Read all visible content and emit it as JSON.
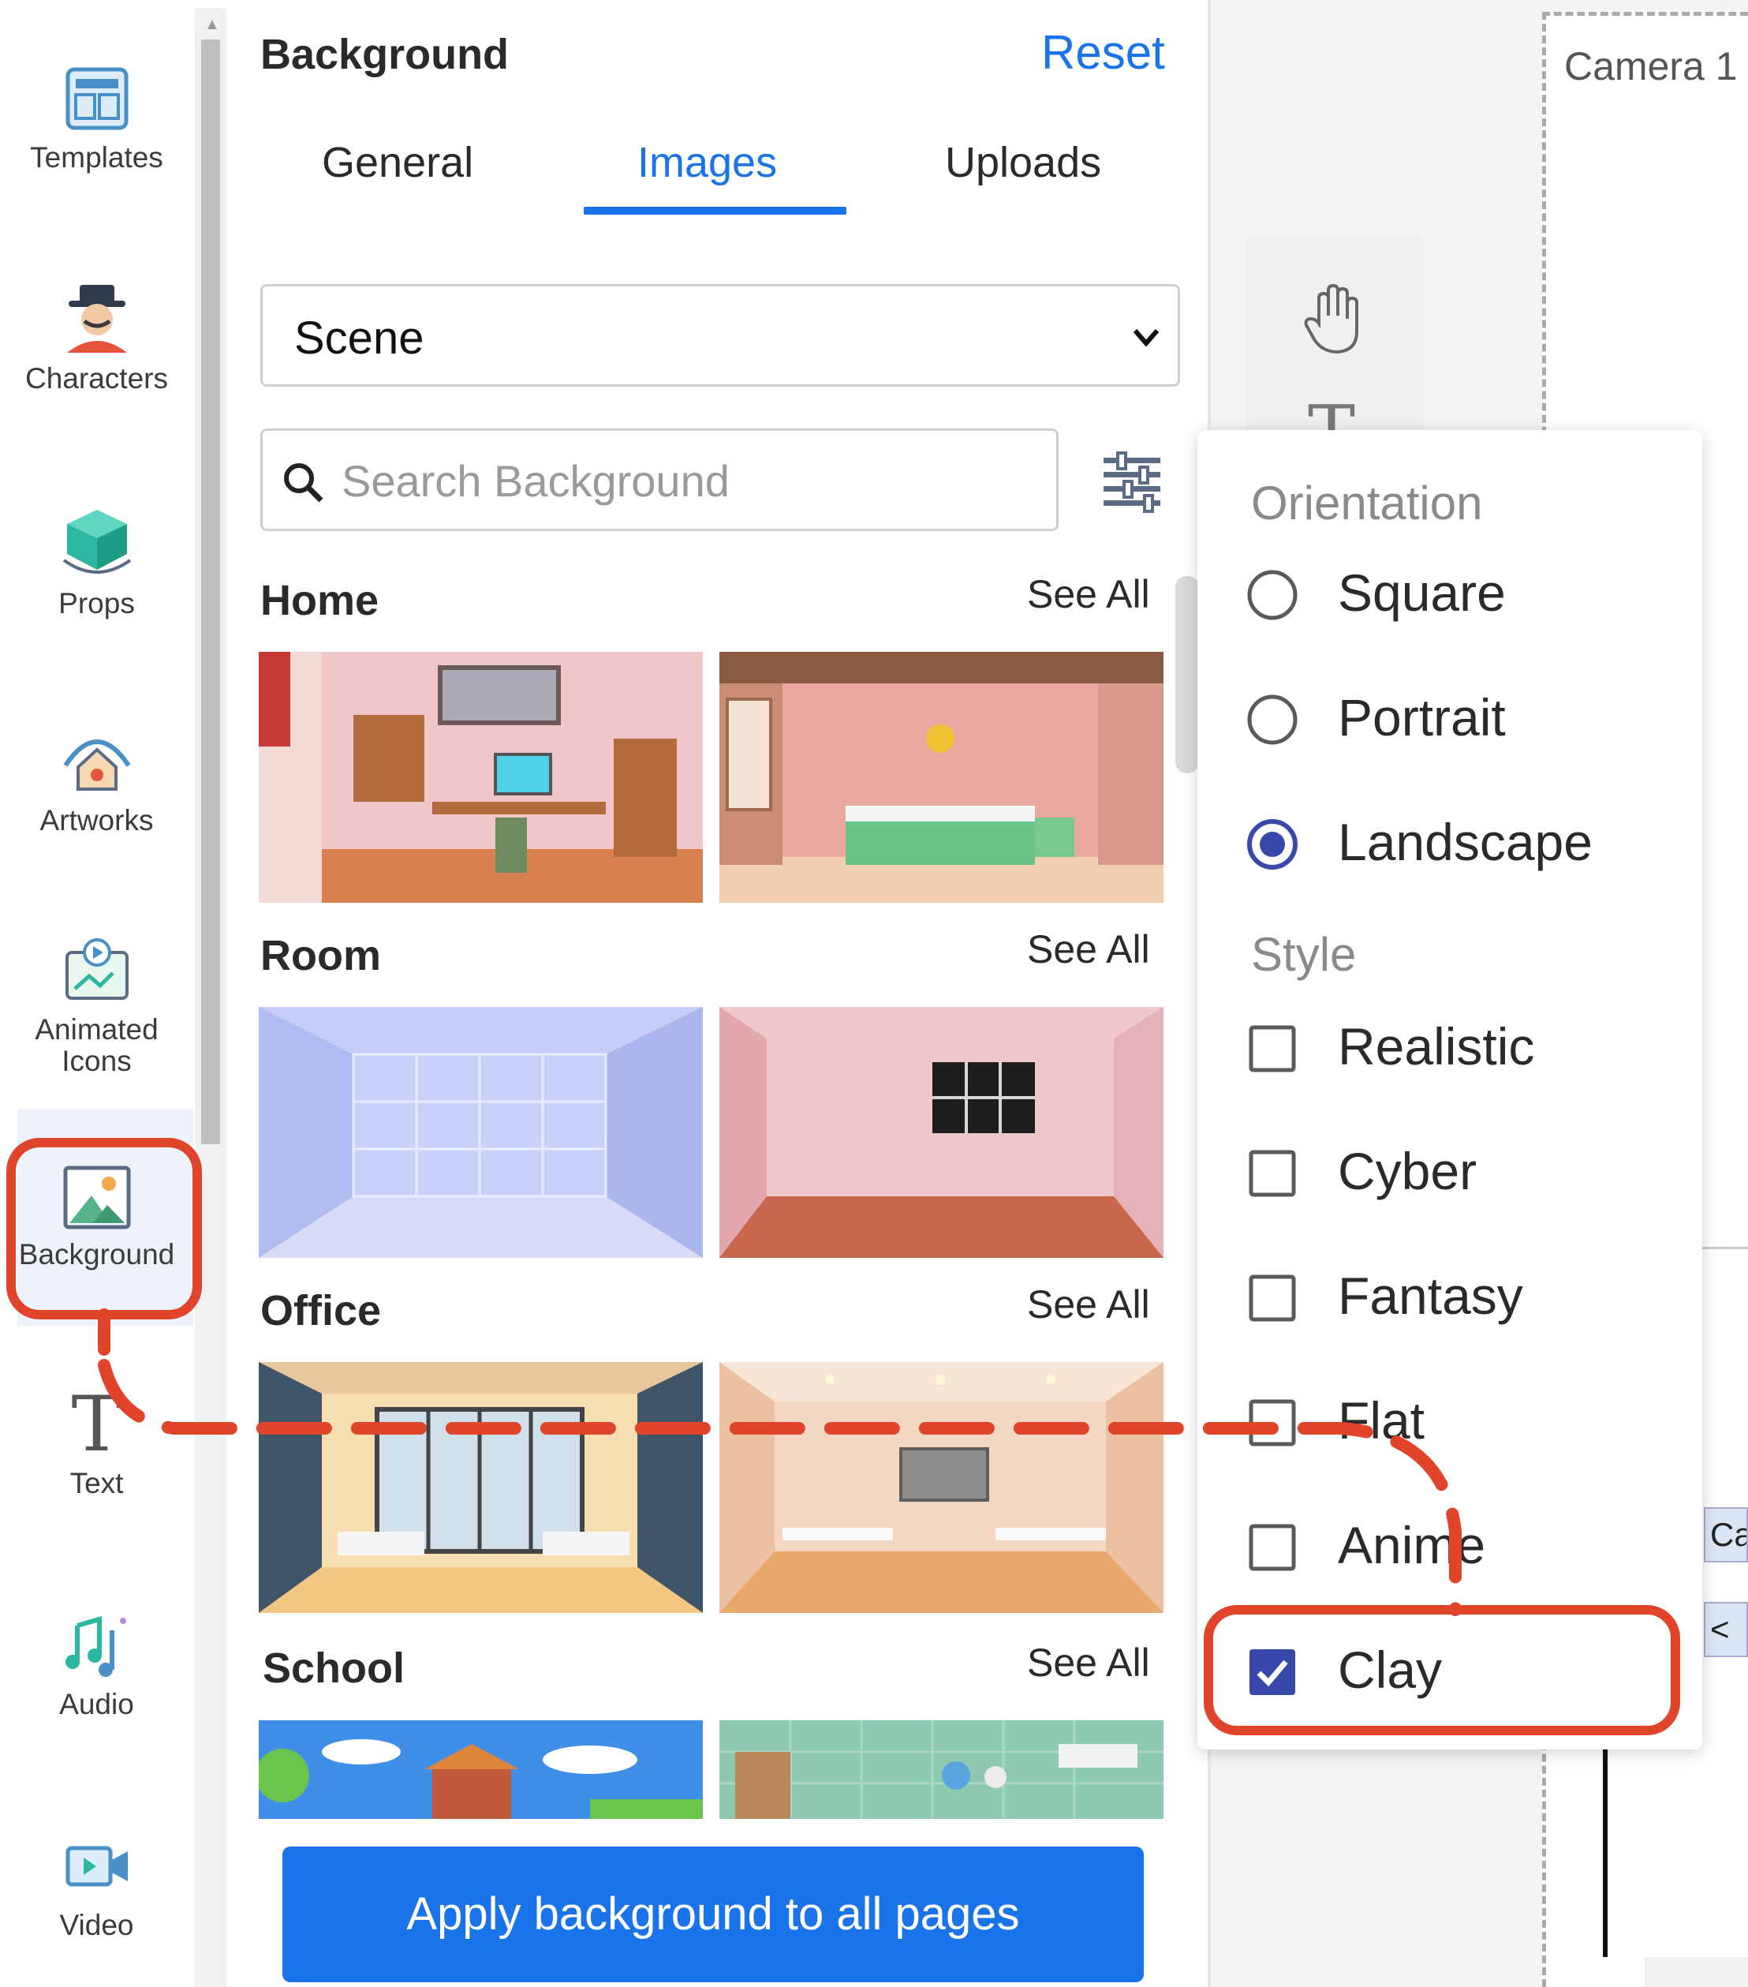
{
  "sidebar": {
    "items": [
      {
        "label": "Templates",
        "icon": "templates-icon"
      },
      {
        "label": "Characters",
        "icon": "character-icon"
      },
      {
        "label": "Props",
        "icon": "cube-icon"
      },
      {
        "label": "Artworks",
        "icon": "artworks-icon"
      },
      {
        "label_line1": "Animated",
        "label_line2": "Icons",
        "icon": "animated-icons-icon"
      },
      {
        "label": "Background",
        "icon": "image-icon",
        "active": true
      },
      {
        "label": "Text",
        "icon": "text-icon"
      },
      {
        "label": "Audio",
        "icon": "music-icon"
      },
      {
        "label": "Video",
        "icon": "video-icon"
      }
    ]
  },
  "panel": {
    "title": "Background",
    "reset_label": "Reset",
    "tabs": [
      {
        "label": "General"
      },
      {
        "label": "Images",
        "active": true
      },
      {
        "label": "Uploads"
      }
    ],
    "category_select": {
      "value": "Scene"
    },
    "search": {
      "placeholder": "Search Background",
      "value": ""
    },
    "sections": [
      {
        "title": "Home",
        "see_all": "See All"
      },
      {
        "title": "Room",
        "see_all": "See All"
      },
      {
        "title": "Office",
        "see_all": "See All"
      },
      {
        "title": "School",
        "see_all": "See All"
      }
    ],
    "apply_button": "Apply background to all pages"
  },
  "canvas": {
    "camera_label": "Camera 1",
    "tool_text_glyph": "T",
    "right_stub_1": "Ca",
    "right_stub_2": "<"
  },
  "filter_popover": {
    "orientation_title": "Orientation",
    "orientation_options": [
      {
        "label": "Square",
        "selected": false
      },
      {
        "label": "Portrait",
        "selected": false
      },
      {
        "label": "Landscape",
        "selected": true
      }
    ],
    "style_title": "Style",
    "style_options": [
      {
        "label": "Realistic",
        "checked": false
      },
      {
        "label": "Cyber",
        "checked": false
      },
      {
        "label": "Fantasy",
        "checked": false
      },
      {
        "label": "Flat",
        "checked": false
      },
      {
        "label": "Anime",
        "checked": false
      },
      {
        "label": "Clay",
        "checked": true
      }
    ]
  },
  "colors": {
    "accent": "#1a73e8",
    "annotation": "#e0442a",
    "checkbox_checked": "#3949ab"
  }
}
